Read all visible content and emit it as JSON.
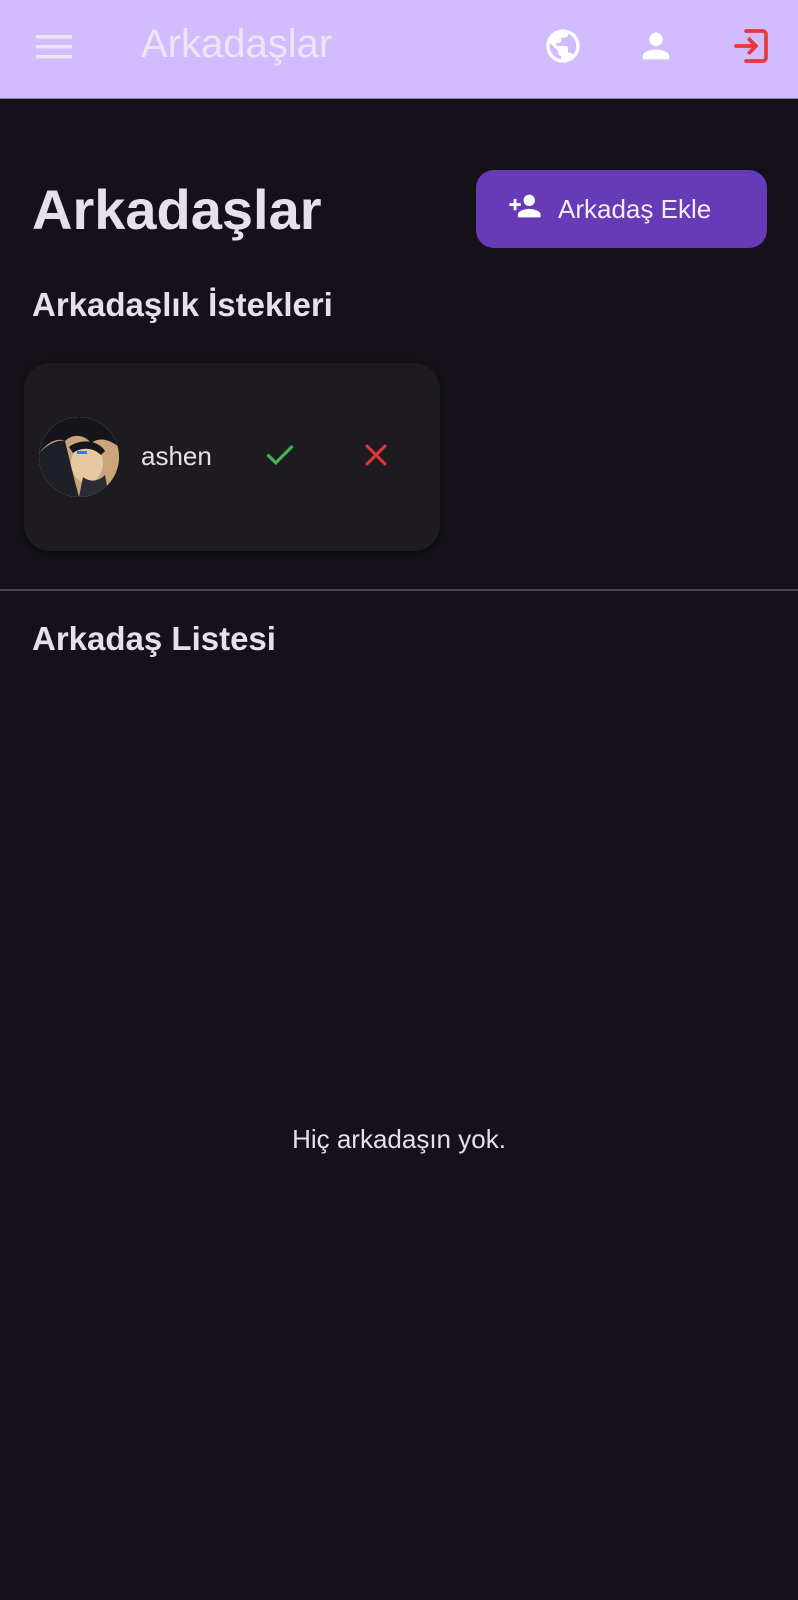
{
  "appbar": {
    "title": "Arkadaşlar",
    "icons": [
      "menu-icon",
      "globe-icon",
      "person-icon",
      "logout-icon"
    ],
    "logout_color": "#e53935"
  },
  "page": {
    "heading": "Arkadaşlar",
    "add_button_label": "Arkadaş Ekle"
  },
  "requests": {
    "title": "Arkadaşlık İstekleri",
    "items": [
      {
        "username": "ashen",
        "accept_icon": "check-icon",
        "decline_icon": "close-icon"
      }
    ]
  },
  "friends": {
    "title": "Arkadaş Listesi",
    "empty_message": "Hiç arkadaşın yok."
  },
  "colors": {
    "appbar_bg": "#d0bcff",
    "background": "#141218",
    "accent": "#673ab7",
    "accept": "#4caf50",
    "decline": "#e53935"
  }
}
